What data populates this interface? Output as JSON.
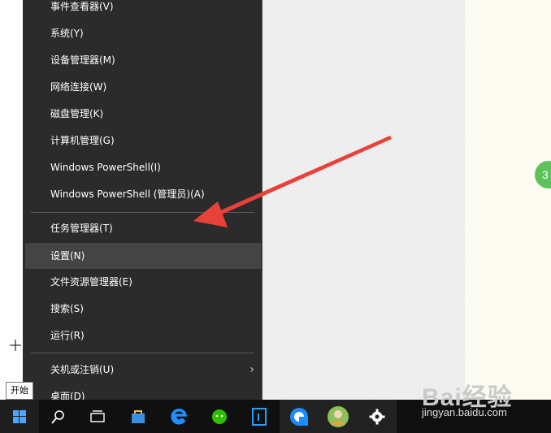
{
  "menu": {
    "groups": [
      [
        {
          "label": "事件查看器(V)"
        },
        {
          "label": "系统(Y)"
        },
        {
          "label": "设备管理器(M)"
        },
        {
          "label": "网络连接(W)"
        },
        {
          "label": "磁盘管理(K)"
        },
        {
          "label": "计算机管理(G)"
        },
        {
          "label": "Windows PowerShell(I)"
        },
        {
          "label": "Windows PowerShell (管理员)(A)"
        }
      ],
      [
        {
          "label": "任务管理器(T)"
        },
        {
          "label": "设置(N)",
          "highlighted": true
        },
        {
          "label": "文件资源管理器(E)"
        },
        {
          "label": "搜索(S)"
        },
        {
          "label": "运行(R)"
        }
      ],
      [
        {
          "label": "关机或注销(U)",
          "has_submenu": true
        },
        {
          "label": "桌面(D)"
        }
      ]
    ]
  },
  "tooltip": {
    "text": "开始"
  },
  "badge": {
    "text": "3"
  },
  "watermark": {
    "brand": "Bai经验",
    "domain": "jingyan.baidu.com"
  },
  "taskbar": {
    "icons": [
      "windows-start-icon",
      "search-icon",
      "task-view-icon",
      "store-icon",
      "edge-icon",
      "wechat-icon",
      "terminal-icon",
      "browser-icon",
      "avatar-icon",
      "settings-gear-icon"
    ]
  },
  "colors": {
    "menu_bg": "#2b2b2b",
    "menu_highlight": "#444444",
    "taskbar_bg": "#101010",
    "arrow": "#e8413a",
    "start_icon": "#4ca6ff"
  }
}
